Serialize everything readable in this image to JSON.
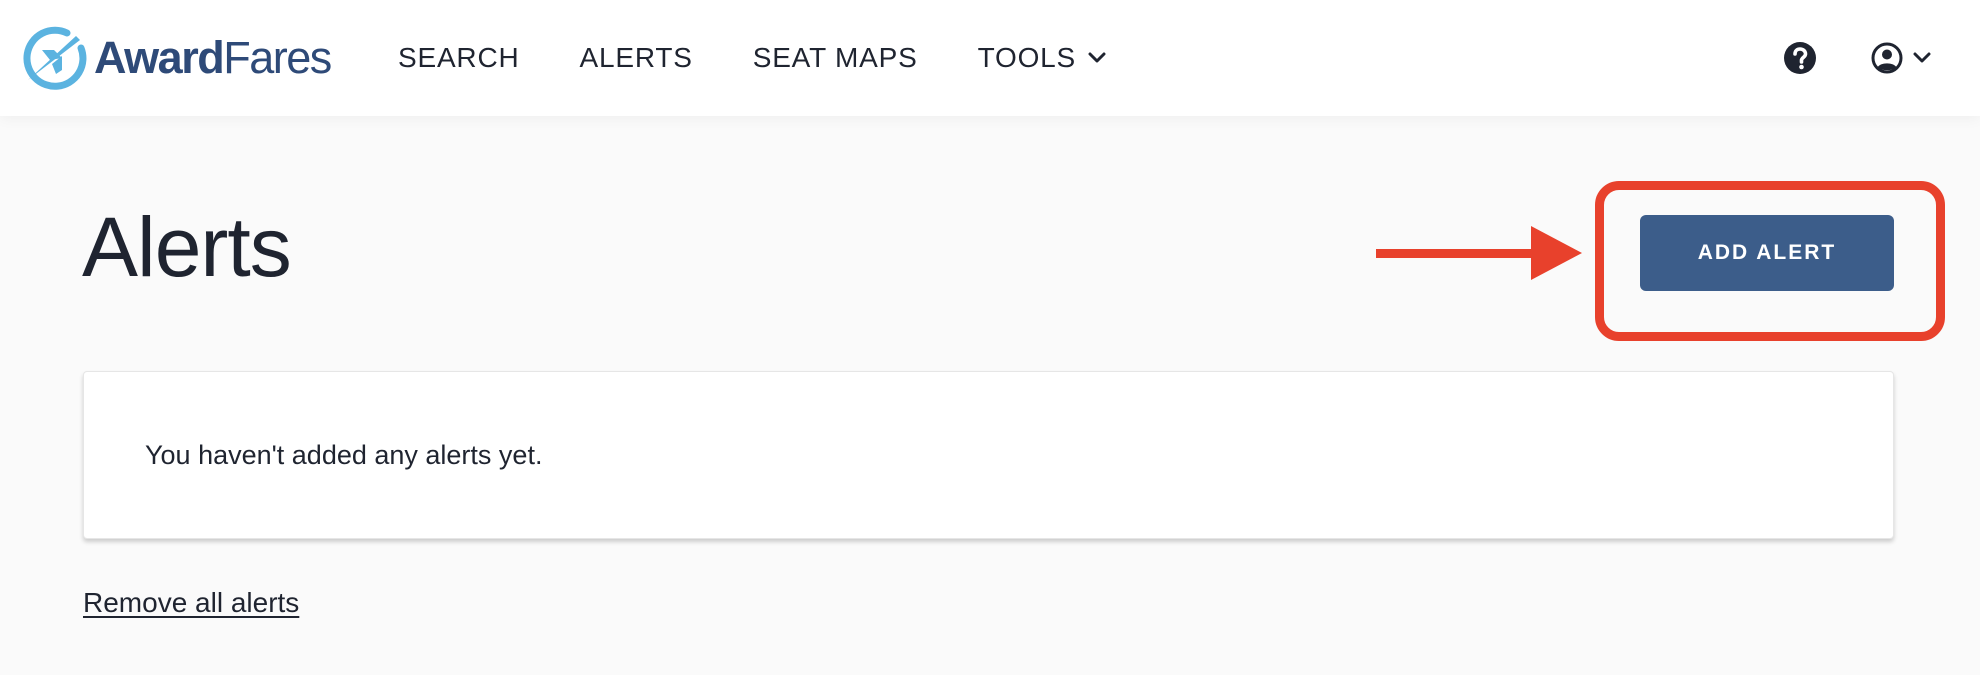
{
  "header": {
    "logo": {
      "word_bold": "Award",
      "word_light": "Fares",
      "brand_color": "#2e4a78",
      "mark_color": "#5bb3e0"
    },
    "nav": [
      {
        "label": "SEARCH"
      },
      {
        "label": "ALERTS"
      },
      {
        "label": "SEAT MAPS"
      },
      {
        "label": "TOOLS",
        "has_dropdown": true
      }
    ],
    "icons": {
      "help": "question-circle-icon",
      "user": "user-circle-icon",
      "user_dropdown": "chevron-down-icon"
    }
  },
  "main": {
    "title": "Alerts",
    "add_alert_label": "ADD ALERT",
    "empty_message": "You haven't added any alerts yet.",
    "remove_all_label": "Remove all alerts"
  },
  "annotation": {
    "color": "#e8412c",
    "arrow": "right-arrow",
    "highlight": "box-around-add-alert"
  },
  "colors": {
    "primary_button": "#3c5d8a",
    "background": "#fafafa",
    "text": "#1f2430"
  }
}
